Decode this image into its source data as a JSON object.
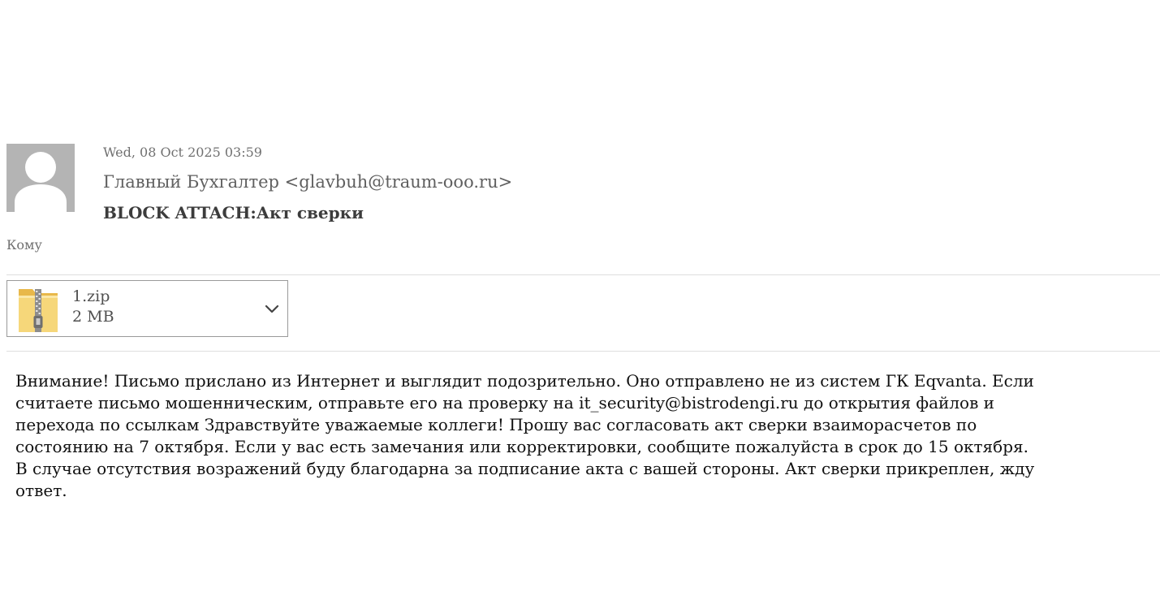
{
  "email": {
    "date": "Wed, 08 Oct 2025 03:59",
    "from": "Главный Бухгалтер <glavbuh@traum-ooo.ru>",
    "subject": "BLOCK ATTACH:Акт сверки",
    "to_label": "Кому",
    "avatar_icon": "user-silhouette-icon",
    "attachment": {
      "icon": "zip-folder-icon",
      "name": "1.zip",
      "size": "2 MB",
      "menu_icon": "chevron-down-icon"
    },
    "body_lines": [
      "Внимание! Письмо прислано из Интернет и выглядит подозрительно. Оно отправлено не из систем ГК Eqvanta. Если",
      "считаете письмо мошенническим, отправьте его на проверку на it_security@bistrodengi.ru до открытия файлов и",
      "перехода по ссылкам Здравствуйте уважаемые коллеги! Прошу вас согласовать акт сверки взаиморасчетов по",
      "состоянию на 7 октября. Если у вас есть замечания или корректировки, сообщите пожалуйста в срок до 15 октября.",
      "В случае отсутствия возражений буду благодарна за подписание акта с вашей стороны. Акт сверки прикреплен, жду",
      "ответ."
    ]
  },
  "colors": {
    "avatar_bg": "#b4b4b4",
    "divider": "#dedede",
    "attachment_border": "#9a9a9a",
    "zip_yellow": "#f6d77a"
  }
}
